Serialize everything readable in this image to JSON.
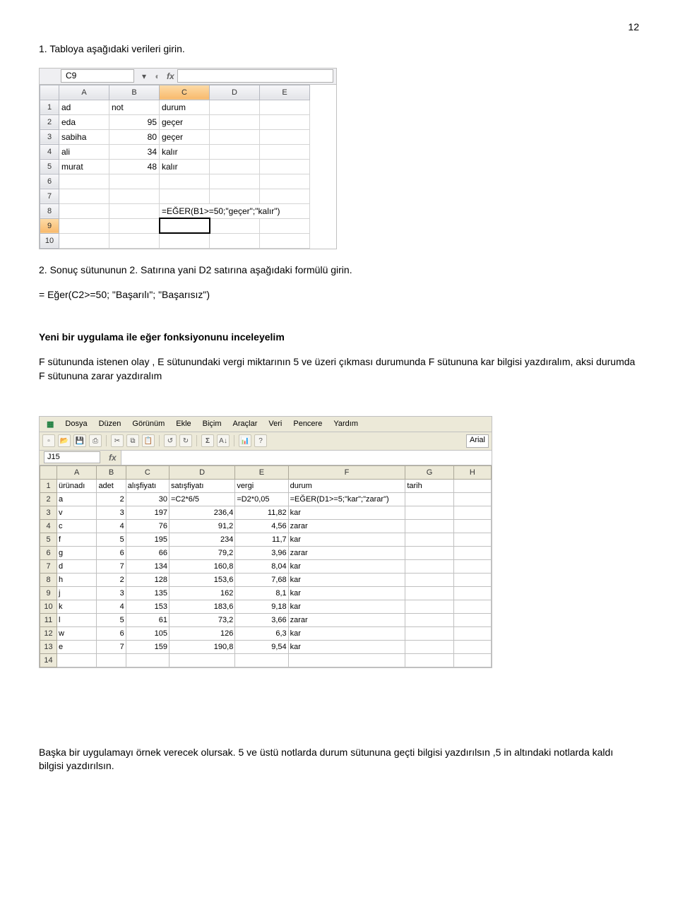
{
  "pageNumber": "12",
  "intro1": "1. Tabloya aşağıdaki verileri girin.",
  "shot1": {
    "nameBox": "C9",
    "cols": [
      "A",
      "B",
      "C",
      "D",
      "E"
    ],
    "rows": [
      {
        "n": "1",
        "A": "ad",
        "B": "not",
        "C": "durum",
        "D": "",
        "E": ""
      },
      {
        "n": "2",
        "A": "eda",
        "B": "95",
        "C": "geçer",
        "D": "",
        "E": ""
      },
      {
        "n": "3",
        "A": "sabiha",
        "B": "80",
        "C": "geçer",
        "D": "",
        "E": ""
      },
      {
        "n": "4",
        "A": "ali",
        "B": "34",
        "C": "kalır",
        "D": "",
        "E": ""
      },
      {
        "n": "5",
        "A": "murat",
        "B": "48",
        "C": "kalır",
        "D": "",
        "E": ""
      },
      {
        "n": "6",
        "A": "",
        "B": "",
        "C": "",
        "D": "",
        "E": ""
      },
      {
        "n": "7",
        "A": "",
        "B": "",
        "C": "",
        "D": "",
        "E": ""
      },
      {
        "n": "8",
        "A": "",
        "B": "",
        "C": "=EĞER(B1>=50;\"geçer\";\"kalır\")",
        "D": "",
        "E": ""
      },
      {
        "n": "9",
        "A": "",
        "B": "",
        "C": "",
        "D": "",
        "E": ""
      },
      {
        "n": "10",
        "A": "",
        "B": "",
        "C": "",
        "D": "",
        "E": ""
      }
    ]
  },
  "intro2": "2. Sonuç sütununun 2. Satırına yani D2 satırına aşağıdaki formülü girin.",
  "formula": "= Eğer(C2>=50; \"Başarılı\"; \"Başarısız\")",
  "heading": "Yeni bir uygulama ile eğer fonksiyonunu inceleyelim",
  "body1": "F sütununda istenen olay , E sütunundaki vergi miktarının 5 ve üzeri çıkması durumunda F sütununa kar bilgisi yazdıralım, aksi durumda F sütununa zarar yazdıralım",
  "shot2": {
    "menus": [
      "Dosya",
      "Düzen",
      "Görünüm",
      "Ekle",
      "Biçim",
      "Araçlar",
      "Veri",
      "Pencere",
      "Yardım"
    ],
    "font": "Arial",
    "sigma": "Σ",
    "nameBox": "J15",
    "cols": [
      "A",
      "B",
      "C",
      "D",
      "E",
      "F",
      "G",
      "H"
    ],
    "rows": [
      {
        "n": "1",
        "A": "ürünadı",
        "B": "adet",
        "C": "alışfiyatı",
        "D": "satışfiyatı",
        "E": "vergi",
        "F": "durum",
        "G": "tarih",
        "H": ""
      },
      {
        "n": "2",
        "A": "a",
        "B": "2",
        "C": "30",
        "D": "=C2*6/5",
        "E": "=D2*0,05",
        "F": "=EĞER(D1>=5;\"kar\";\"zarar\")",
        "G": "",
        "H": ""
      },
      {
        "n": "3",
        "A": "v",
        "B": "3",
        "C": "197",
        "D": "236,4",
        "E": "11,82",
        "F": "kar",
        "G": "",
        "H": ""
      },
      {
        "n": "4",
        "A": "c",
        "B": "4",
        "C": "76",
        "D": "91,2",
        "E": "4,56",
        "F": "zarar",
        "G": "",
        "H": ""
      },
      {
        "n": "5",
        "A": "f",
        "B": "5",
        "C": "195",
        "D": "234",
        "E": "11,7",
        "F": "kar",
        "G": "",
        "H": ""
      },
      {
        "n": "6",
        "A": "g",
        "B": "6",
        "C": "66",
        "D": "79,2",
        "E": "3,96",
        "F": "zarar",
        "G": "",
        "H": ""
      },
      {
        "n": "7",
        "A": "d",
        "B": "7",
        "C": "134",
        "D": "160,8",
        "E": "8,04",
        "F": "kar",
        "G": "",
        "H": ""
      },
      {
        "n": "8",
        "A": "h",
        "B": "2",
        "C": "128",
        "D": "153,6",
        "E": "7,68",
        "F": "kar",
        "G": "",
        "H": ""
      },
      {
        "n": "9",
        "A": "j",
        "B": "3",
        "C": "135",
        "D": "162",
        "E": "8,1",
        "F": "kar",
        "G": "",
        "H": ""
      },
      {
        "n": "10",
        "A": "k",
        "B": "4",
        "C": "153",
        "D": "183,6",
        "E": "9,18",
        "F": "kar",
        "G": "",
        "H": ""
      },
      {
        "n": "11",
        "A": "l",
        "B": "5",
        "C": "61",
        "D": "73,2",
        "E": "3,66",
        "F": "zarar",
        "G": "",
        "H": ""
      },
      {
        "n": "12",
        "A": "w",
        "B": "6",
        "C": "105",
        "D": "126",
        "E": "6,3",
        "F": "kar",
        "G": "",
        "H": ""
      },
      {
        "n": "13",
        "A": "e",
        "B": "7",
        "C": "159",
        "D": "190,8",
        "E": "9,54",
        "F": "kar",
        "G": "",
        "H": ""
      },
      {
        "n": "14",
        "A": "",
        "B": "",
        "C": "",
        "D": "",
        "E": "",
        "F": "",
        "G": "",
        "H": ""
      }
    ]
  },
  "body2": "Başka bir uygulamayı örnek verecek olursak. 5 ve üstü notlarda durum sütununa geçti bilgisi yazdırılsın ,5 in altındaki notlarda kaldı bilgisi yazdırılsın."
}
